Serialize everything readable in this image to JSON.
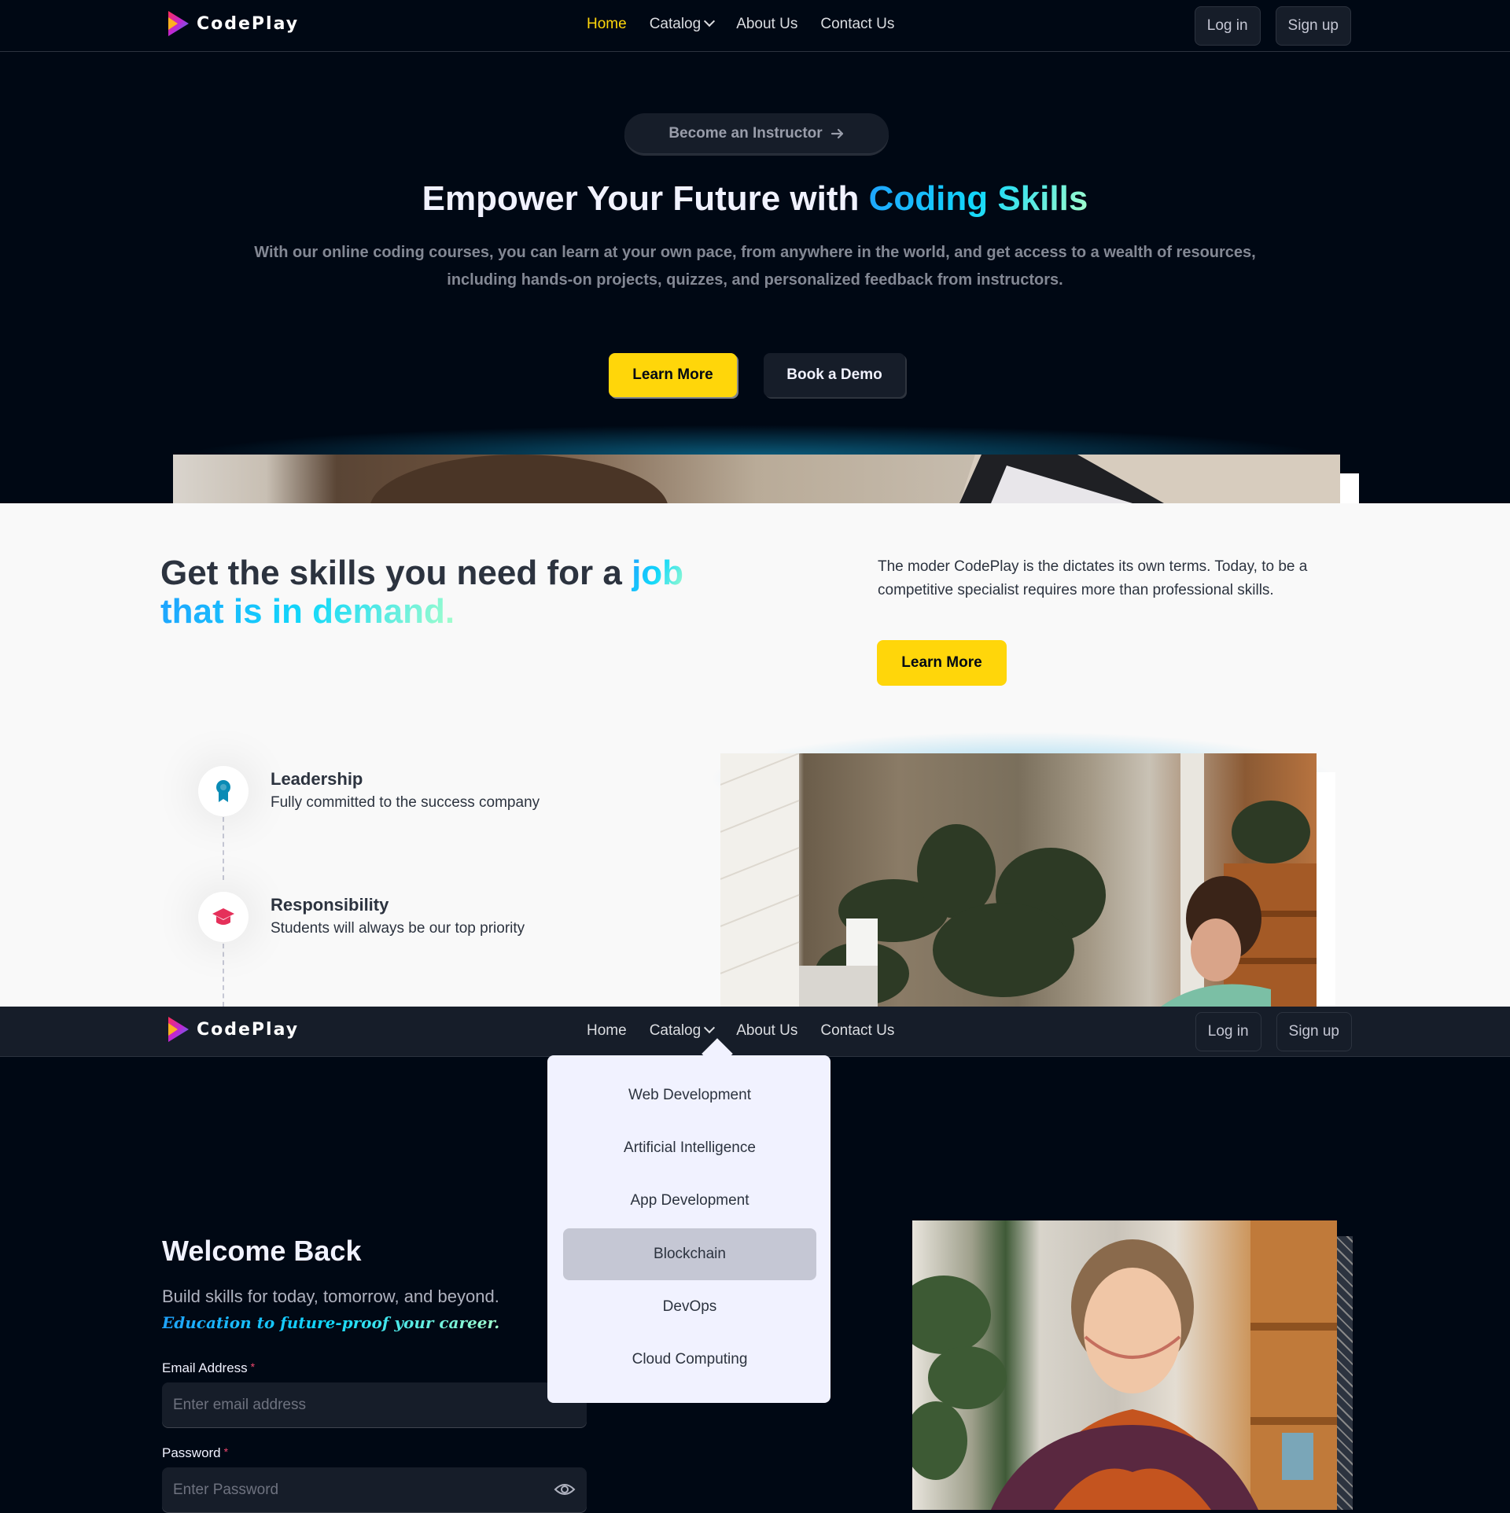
{
  "brand": {
    "name": "CodePlay"
  },
  "nav": {
    "items": [
      "Home",
      "Catalog",
      "About Us",
      "Contact Us"
    ],
    "login": "Log in",
    "signup": "Sign up"
  },
  "hero": {
    "instructor_pill": "Become an Instructor",
    "title_plain": "Empower Your Future with ",
    "title_highlight": "Coding Skills",
    "subtitle": "With our online coding courses, you can learn at your own pace, from anywhere in the world, and get access to a wealth of resources, including hands-on projects, quizzes, and personalized feedback from instructors.",
    "learn_more": "Learn More",
    "book_demo": "Book a Demo"
  },
  "skills": {
    "title_plain": "Get the skills you need for a ",
    "title_highlight_1": "job",
    "title_highlight_2": "that is in demand.",
    "text": "The moder CodePlay is the dictates its own terms. Today, to be a competitive specialist requires more than professional skills.",
    "learn_more": "Learn More"
  },
  "timeline": [
    {
      "title": "Leadership",
      "desc": "Fully committed to the success company",
      "icon": "medal-icon"
    },
    {
      "title": "Responsibility",
      "desc": "Students will always be our top priority",
      "icon": "graduation-cap-icon"
    }
  ],
  "catalog_dropdown": {
    "items": [
      "Web Development",
      "Artificial Intelligence",
      "App Development",
      "Blockchain",
      "DevOps",
      "Cloud Computing"
    ],
    "highlighted": "Blockchain"
  },
  "login": {
    "title": "Welcome Back",
    "subtitle": "Build skills for today, tomorrow, and beyond.",
    "subtitle_italic": "Education to future-proof your career.",
    "email_label": "Email Address",
    "email_placeholder": "Enter email address",
    "password_label": "Password",
    "password_placeholder": "Enter Password",
    "required_mark": "*"
  },
  "colors": {
    "bg_dark": "#000814",
    "accent_yellow": "#ffd60a",
    "highlight_gradient_start": "#1fa2ff",
    "highlight_gradient_end": "#a6ffcb",
    "required": "#ef476f"
  }
}
